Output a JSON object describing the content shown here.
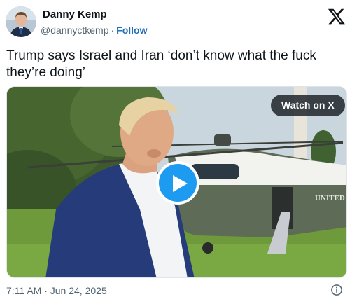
{
  "author": {
    "name": "Danny Kemp",
    "handle": "@dannyctkemp",
    "separator": "·",
    "follow_label": "Follow"
  },
  "header": {
    "logo_icon": "x-logo-icon"
  },
  "tweet": {
    "text": "Trump says Israel and Iran ‘don’t know what the fuck they’re doing’"
  },
  "media": {
    "watch_label": "Watch on X",
    "play_icon": "play-icon",
    "aircraft_lettering": "UNITED"
  },
  "footer": {
    "timestamp": "7:11 AM · Jun 24, 2025",
    "info_icon": "info-icon"
  },
  "colors": {
    "accent": "#1d9bf0",
    "follow": "#1d6fb8",
    "secondary_text": "#536471",
    "primary_text": "#0f1419"
  }
}
